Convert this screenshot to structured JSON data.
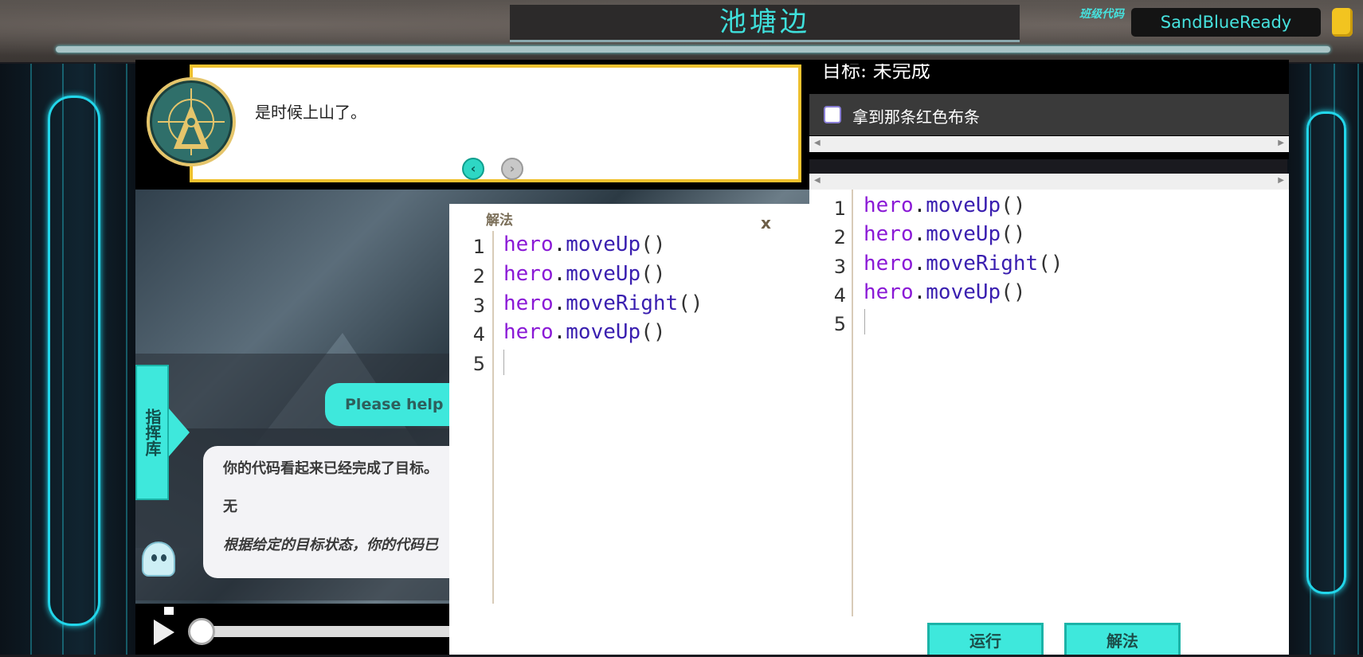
{
  "header": {
    "level_title": "池塘边",
    "class_code_label": "班级代码",
    "class_code_value": "SandBlueReady"
  },
  "dialog": {
    "text": "是时候上山了。",
    "prev_icon": "chevron-left-icon",
    "next_icon": "chevron-right-icon"
  },
  "chat": {
    "tab_label": "指挥库",
    "user_message": "Please help me",
    "ai_messages": [
      "你的代码看起来已经完成了目标。",
      "无",
      "根据给定的目标状态，你的代码已"
    ]
  },
  "solution": {
    "title": "解法",
    "close_label": "x",
    "line_numbers": [
      "1",
      "2",
      "3",
      "4",
      "5"
    ],
    "lines": [
      {
        "obj": "hero",
        "dot": ".",
        "fn": "moveUp",
        "paren": "()"
      },
      {
        "obj": "hero",
        "dot": ".",
        "fn": "moveUp",
        "paren": "()"
      },
      {
        "obj": "hero",
        "dot": ".",
        "fn": "moveRight",
        "paren": "()"
      },
      {
        "obj": "hero",
        "dot": ".",
        "fn": "moveUp",
        "paren": "()"
      }
    ]
  },
  "goals": {
    "header": "目标: 未完成",
    "items": [
      {
        "label": "拿到那条红色布条",
        "checked": false
      }
    ]
  },
  "editor": {
    "line_numbers": [
      "1",
      "2",
      "3",
      "4",
      "5"
    ],
    "lines": [
      {
        "obj": "hero",
        "dot": ".",
        "fn": "moveUp",
        "paren": "()"
      },
      {
        "obj": "hero",
        "dot": ".",
        "fn": "moveUp",
        "paren": "()"
      },
      {
        "obj": "hero",
        "dot": ".",
        "fn": "moveRight",
        "paren": "()"
      },
      {
        "obj": "hero",
        "dot": ".",
        "fn": "moveUp",
        "paren": "()"
      }
    ]
  },
  "buttons": {
    "run": "运行",
    "solution": "解法"
  },
  "colors": {
    "accent": "#3ee8dc",
    "dialog_border": "#f1c22f",
    "code_object": "#8a19d6",
    "code_function": "#3a1fb0"
  }
}
